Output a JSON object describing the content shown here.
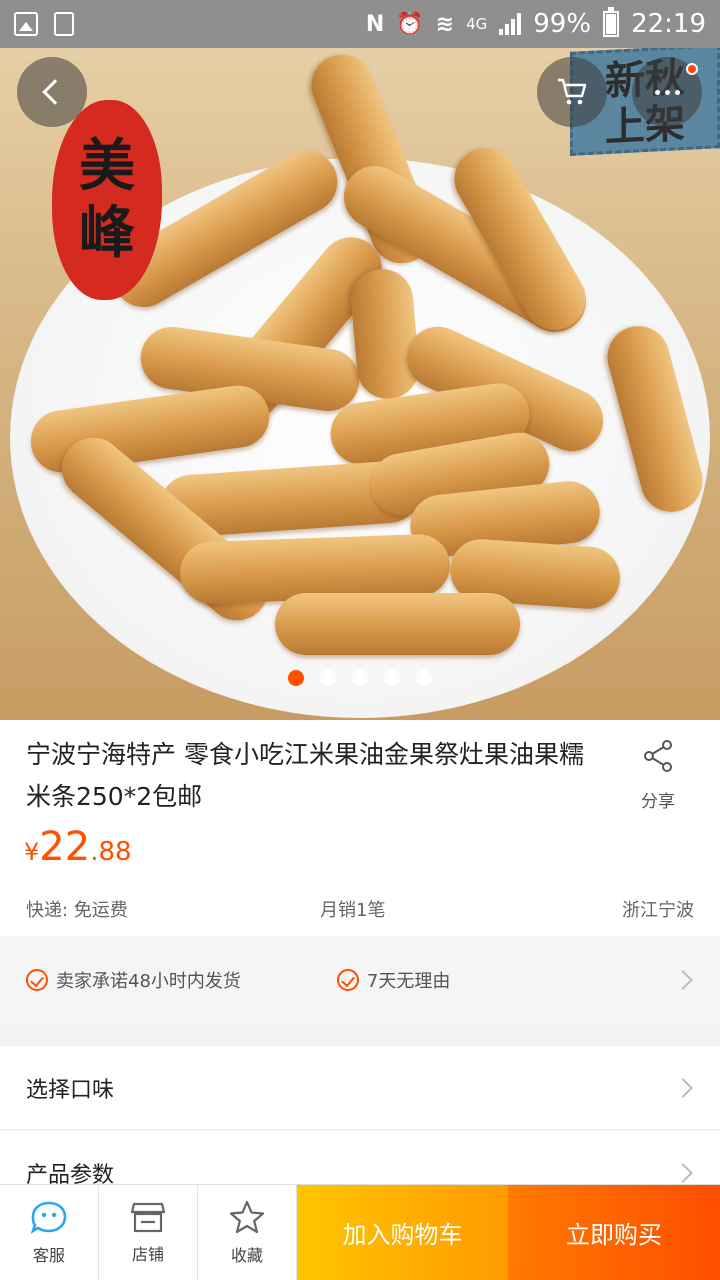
{
  "status_bar": {
    "network": "4G",
    "battery": "99%",
    "time": "22:19"
  },
  "hero": {
    "seal_text": [
      "美",
      "峰"
    ],
    "badge_text": [
      "新秋",
      "上架"
    ],
    "carousel": {
      "count": 5,
      "active_index": 0
    },
    "colors": {
      "accent": "#ff5000"
    }
  },
  "product": {
    "title": "宁波宁海特产 零食小吃江米果油金果祭灶果油果糯米条250*2包邮",
    "share_label": "分享",
    "price": {
      "currency": "¥",
      "integer": "22",
      "decimal": ".88"
    },
    "shipping": "快递: 免运费",
    "monthly_sales": "月销1笔",
    "location": "浙江宁波"
  },
  "services": {
    "items": [
      "卖家承诺48小时内发货",
      "7天无理由"
    ]
  },
  "options": {
    "flavor_label": "选择口味",
    "params_label": "产品参数"
  },
  "bottom_bar": {
    "service_label": "客服",
    "shop_label": "店铺",
    "favorite_label": "收藏",
    "add_to_cart_label": "加入购物车",
    "buy_now_label": "立即购买"
  }
}
